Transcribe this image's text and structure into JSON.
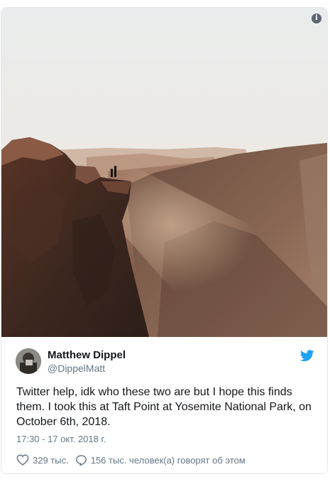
{
  "media": {
    "alt_icon": "info-icon"
  },
  "tweet": {
    "author_name": "Matthew Dippel",
    "author_handle": "@DippelMatt",
    "text": "Twitter help, idk who these two are but I hope this finds them. I took this at Taft Point at Yosemite National Park, on October 6th, 2018.",
    "timestamp": "17:30 - 17 окт. 2018 г.",
    "likes": "329 тыс.",
    "replies": "156 тыс. человек(а) говорят об этом"
  },
  "colors": {
    "brand": "#1da1f2",
    "text": "#14171a",
    "muted": "#657786",
    "border": "#e1e8ed"
  },
  "icons": {
    "like": "heart-icon",
    "reply": "speech-bubble-icon",
    "brand": "twitter-bird-icon"
  }
}
